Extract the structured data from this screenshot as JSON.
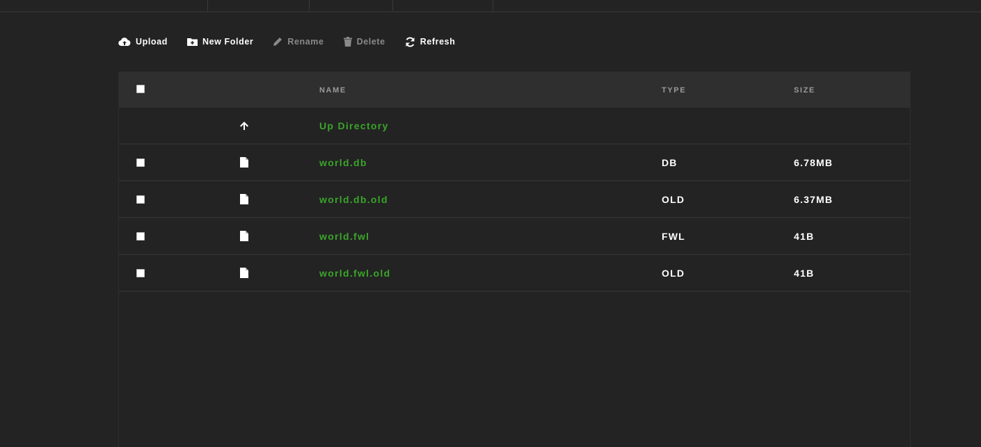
{
  "toolbar": {
    "upload_label": "Upload",
    "new_folder_label": "New Folder",
    "rename_label": "Rename",
    "delete_label": "Delete",
    "refresh_label": "Refresh"
  },
  "table": {
    "columns": {
      "name": "NAME",
      "type": "TYPE",
      "size": "SIZE"
    },
    "up_directory_label": "Up Directory",
    "rows": [
      {
        "name": "world.db",
        "type": "DB",
        "size": "6.78MB",
        "icon": "file-icon"
      },
      {
        "name": "world.db.old",
        "type": "OLD",
        "size": "6.37MB",
        "icon": "file-icon"
      },
      {
        "name": "world.fwl",
        "type": "FWL",
        "size": "41B",
        "icon": "file-icon"
      },
      {
        "name": "world.fwl.old",
        "type": "OLD",
        "size": "41B",
        "icon": "file-icon"
      }
    ]
  },
  "colors": {
    "background": "#232323",
    "header_bg": "#2f2f2f",
    "link_green": "#3aa52a",
    "disabled_text": "#8a8a8a"
  }
}
